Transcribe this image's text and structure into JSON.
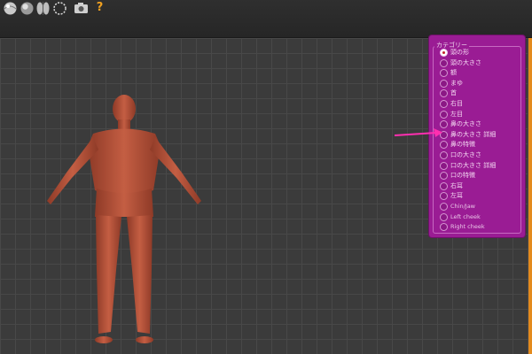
{
  "toolbar": {
    "icons": [
      "sphere-tool-icon",
      "shaded-sphere-icon",
      "mirror-tool-icon",
      "selection-circle-icon",
      "camera-icon",
      "help-icon"
    ],
    "help_label": "?"
  },
  "category_panel": {
    "title": "カテゴリー",
    "selected_index": 0,
    "options": [
      {
        "label": "頭の形"
      },
      {
        "label": "頭の大きさ"
      },
      {
        "label": "額"
      },
      {
        "label": "まゆ"
      },
      {
        "label": "首"
      },
      {
        "label": "右目"
      },
      {
        "label": "左目"
      },
      {
        "label": "鼻の大きさ"
      },
      {
        "label": "鼻の大きさ 詳細"
      },
      {
        "label": "鼻の特徴"
      },
      {
        "label": "口の大きさ"
      },
      {
        "label": "口の大きさ 詳細"
      },
      {
        "label": "口の特徴"
      },
      {
        "label": "右耳"
      },
      {
        "label": "左耳"
      },
      {
        "label": "Chin/Jaw"
      },
      {
        "label": "Left cheek"
      },
      {
        "label": "Right cheek"
      }
    ]
  },
  "colors": {
    "panel": "#9a1c94",
    "arrow": "#ff2fb0",
    "accent": "#e38a1d",
    "model_skin": "#b8533a"
  }
}
